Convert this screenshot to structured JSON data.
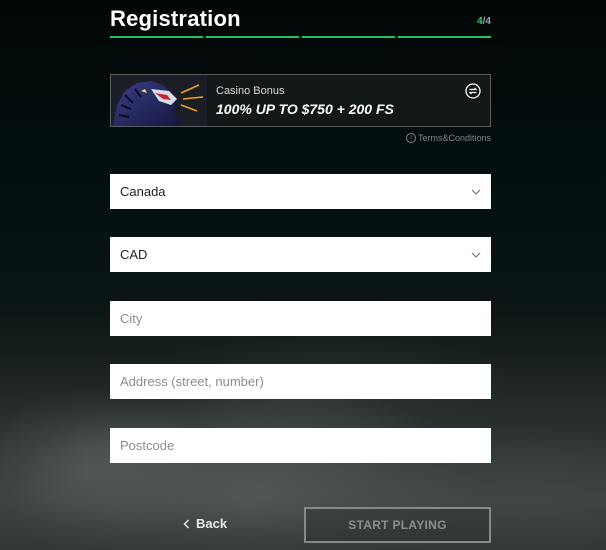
{
  "header": {
    "title": "Registration",
    "step_current": "4",
    "step_total": "/4",
    "step_segments": 4
  },
  "bonus": {
    "label": "Casino Bonus",
    "offer": "100% UP TO $750 + 200 FS",
    "swap_icon": "swap-icon",
    "terms_label": "Terms&Conditions"
  },
  "form": {
    "country": "Canada",
    "currency": "CAD",
    "city_placeholder": "City",
    "address_placeholder": "Address (street, number)",
    "postcode_placeholder": "Postcode"
  },
  "actions": {
    "back_label": "Back",
    "start_label": "START PLAYING"
  },
  "colors": {
    "accent": "#21c364",
    "background": "#020404",
    "field": "#ffffff"
  }
}
